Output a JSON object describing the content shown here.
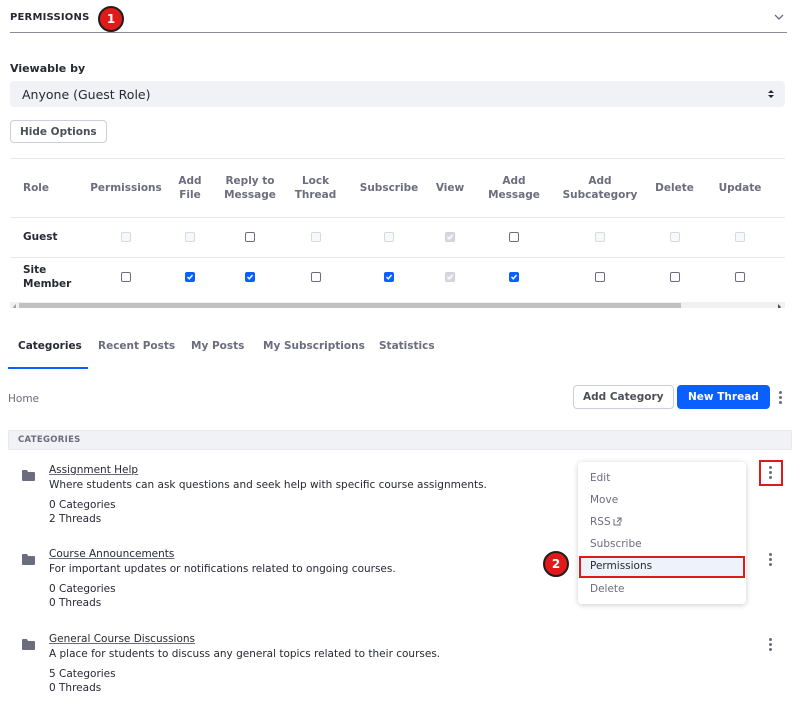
{
  "permissions": {
    "title": "PERMISSIONS",
    "badge1": "1",
    "viewable_label": "Viewable by",
    "viewable_value": "Anyone (Guest Role)",
    "hide_options": "Hide Options",
    "columns": [
      "Role",
      "Permissions",
      "Add File",
      "Reply to Message",
      "Lock Thread",
      "Subscribe",
      "View",
      "Add Message",
      "Add Subcategory",
      "Delete",
      "Update"
    ],
    "column_lines": [
      [
        "Role"
      ],
      [
        "Permissions"
      ],
      [
        "Add",
        "File"
      ],
      [
        "Reply to",
        "Message"
      ],
      [
        "Lock",
        "Thread"
      ],
      [
        "Subscribe"
      ],
      [
        "View"
      ],
      [
        "Add",
        "Message"
      ],
      [
        "Add",
        "Subcategory"
      ],
      [
        "Delete"
      ],
      [
        "Update"
      ]
    ],
    "rows": [
      {
        "role": "Guest",
        "role_lines": [
          "Guest"
        ],
        "cells": [
          "disabled",
          "disabled",
          "unchecked",
          "disabled",
          "disabled",
          "checked-disabled",
          "unchecked",
          "disabled",
          "disabled",
          "disabled"
        ]
      },
      {
        "role": "Site Member",
        "role_lines": [
          "Site",
          "Member"
        ],
        "cells": [
          "unchecked",
          "checked",
          "checked",
          "unchecked",
          "checked",
          "checked-disabled",
          "checked",
          "unchecked",
          "unchecked",
          "unchecked"
        ]
      }
    ]
  },
  "tabs": [
    "Categories",
    "Recent Posts",
    "My Posts",
    "My Subscriptions",
    "Statistics"
  ],
  "active_tab": "Categories",
  "breadcrumb": "Home",
  "buttons": {
    "add_category": "Add Category",
    "new_thread": "New Thread"
  },
  "categories_header": "CATEGORIES",
  "categories": [
    {
      "name": "Assignment Help",
      "description": "Where students can ask questions and seek help with specific course assignments.",
      "subcategories": "0 Categories",
      "threads": "2 Threads"
    },
    {
      "name": "Course Announcements",
      "description": "For important updates or notifications related to ongoing courses.",
      "subcategories": "0 Categories",
      "threads": "0 Threads"
    },
    {
      "name": "General Course Discussions",
      "description": "A place for students to discuss any general topics related to their courses.",
      "subcategories": "5 Categories",
      "threads": "0 Threads"
    }
  ],
  "menu": {
    "items": [
      "Edit",
      "Move",
      "RSS",
      "Subscribe",
      "Permissions",
      "Delete"
    ],
    "highlighted": "Permissions",
    "badge2": "2"
  },
  "colors": {
    "accent": "#0b5fff",
    "annotation": "#e01a1a"
  }
}
